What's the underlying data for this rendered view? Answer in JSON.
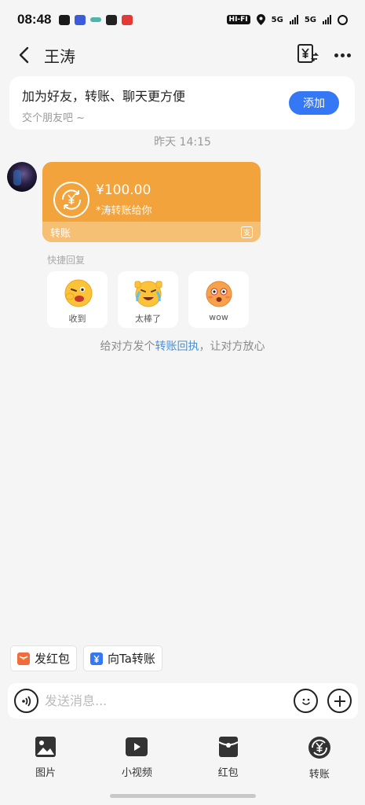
{
  "status_bar": {
    "time": "08:48",
    "hifi": "HI-FI",
    "net1": "5G",
    "net2": "5G",
    "app_colors": [
      "#1a1a1a",
      "#3b5bdb",
      "#4db6ac",
      "#222222",
      "#e53935"
    ]
  },
  "header": {
    "title": "王涛",
    "back_icon": "chevron-left-icon",
    "transfer_icon": "yen-transfer-icon",
    "more_icon": "more-dots-icon"
  },
  "friend_banner": {
    "title": "加为好友，转账、聊天更方便",
    "subtitle": "交个朋友吧 ~",
    "button_label": "添加"
  },
  "chat": {
    "timestamp": "昨天 14:15",
    "transfer": {
      "amount": "¥100.00",
      "note": "*涛转账给你",
      "footer_label": "转账",
      "alipay_glyph": "支"
    },
    "quick_reply_label": "快捷回复",
    "quick_replies": [
      {
        "label": "收到",
        "emoji": "😜"
      },
      {
        "label": "太棒了",
        "emoji": "😭"
      },
      {
        "label": "wow",
        "emoji": "😳"
      }
    ],
    "hint": {
      "prefix": "给对方发个",
      "link": "转账回执",
      "suffix": "，让对方放心"
    }
  },
  "shortcuts": [
    {
      "label": "发红包",
      "icon": "red-envelope-icon"
    },
    {
      "label": "向Ta转账",
      "icon": "yen-icon"
    }
  ],
  "composer": {
    "placeholder": "发送消息..."
  },
  "toolbar": {
    "items": [
      {
        "label": "图片",
        "icon": "image-icon"
      },
      {
        "label": "小视频",
        "icon": "video-icon"
      },
      {
        "label": "红包",
        "icon": "red-envelope-icon"
      },
      {
        "label": "转账",
        "icon": "transfer-icon"
      }
    ]
  },
  "colors": {
    "accent": "#3478f6",
    "transfer_card": "#f2a33c",
    "transfer_footer": "#f5c074",
    "link": "#4a8fd8"
  }
}
